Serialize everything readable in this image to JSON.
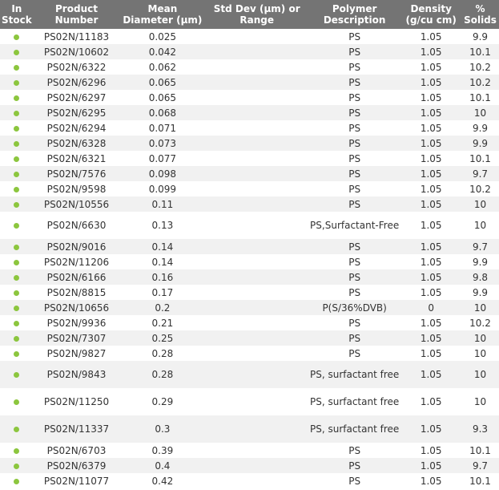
{
  "table": {
    "headers": {
      "stock": "In Stock",
      "product": "Product Number",
      "diameter": "Mean Diameter (µm)",
      "stddev": "Std Dev (µm) or Range",
      "polymer": "Polymer Description",
      "density": "Density (g/cu cm)",
      "solids": "% Solids"
    },
    "stock_indicator_color": "#8cc63e",
    "rows": [
      {
        "stock": "in-stock-dot",
        "product": "PS02N/11183",
        "diameter": "0.025",
        "stddev": "",
        "polymer": "PS",
        "density": "1.05",
        "solids": "9.9"
      },
      {
        "stock": "in-stock-dot",
        "product": "PS02N/10602",
        "diameter": "0.042",
        "stddev": "",
        "polymer": "PS",
        "density": "1.05",
        "solids": "10.1"
      },
      {
        "stock": "in-stock-dot",
        "product": "PS02N/6322",
        "diameter": "0.062",
        "stddev": "",
        "polymer": "PS",
        "density": "1.05",
        "solids": "10.2"
      },
      {
        "stock": "in-stock-dot",
        "product": "PS02N/6296",
        "diameter": "0.065",
        "stddev": "",
        "polymer": "PS",
        "density": "1.05",
        "solids": "10.2"
      },
      {
        "stock": "in-stock-dot",
        "product": "PS02N/6297",
        "diameter": "0.065",
        "stddev": "",
        "polymer": "PS",
        "density": "1.05",
        "solids": "10.1"
      },
      {
        "stock": "in-stock-dot",
        "product": "PS02N/6295",
        "diameter": "0.068",
        "stddev": "",
        "polymer": "PS",
        "density": "1.05",
        "solids": "10"
      },
      {
        "stock": "in-stock-dot",
        "product": "PS02N/6294",
        "diameter": "0.071",
        "stddev": "",
        "polymer": "PS",
        "density": "1.05",
        "solids": "9.9"
      },
      {
        "stock": "in-stock-dot",
        "product": "PS02N/6328",
        "diameter": "0.073",
        "stddev": "",
        "polymer": "PS",
        "density": "1.05",
        "solids": "9.9"
      },
      {
        "stock": "in-stock-dot",
        "product": "PS02N/6321",
        "diameter": "0.077",
        "stddev": "",
        "polymer": "PS",
        "density": "1.05",
        "solids": "10.1"
      },
      {
        "stock": "in-stock-dot",
        "product": "PS02N/7576",
        "diameter": "0.098",
        "stddev": "",
        "polymer": "PS",
        "density": "1.05",
        "solids": "9.7"
      },
      {
        "stock": "in-stock-dot",
        "product": "PS02N/9598",
        "diameter": "0.099",
        "stddev": "",
        "polymer": "PS",
        "density": "1.05",
        "solids": "10.2"
      },
      {
        "stock": "in-stock-dot",
        "product": "PS02N/10556",
        "diameter": "0.11",
        "stddev": "",
        "polymer": "PS",
        "density": "1.05",
        "solids": "10"
      },
      {
        "stock": "in-stock-dot",
        "product": "PS02N/6630",
        "diameter": "0.13",
        "stddev": "",
        "polymer": "PS,Surfactant-Free",
        "density": "1.05",
        "solids": "10",
        "tall": true
      },
      {
        "stock": "in-stock-dot",
        "product": "PS02N/9016",
        "diameter": "0.14",
        "stddev": "",
        "polymer": "PS",
        "density": "1.05",
        "solids": "9.7"
      },
      {
        "stock": "in-stock-dot",
        "product": "PS02N/11206",
        "diameter": "0.14",
        "stddev": "",
        "polymer": "PS",
        "density": "1.05",
        "solids": "9.9"
      },
      {
        "stock": "in-stock-dot",
        "product": "PS02N/6166",
        "diameter": "0.16",
        "stddev": "",
        "polymer": "PS",
        "density": "1.05",
        "solids": "9.8"
      },
      {
        "stock": "in-stock-dot",
        "product": "PS02N/8815",
        "diameter": "0.17",
        "stddev": "",
        "polymer": "PS",
        "density": "1.05",
        "solids": "9.9"
      },
      {
        "stock": "in-stock-dot",
        "product": "PS02N/10656",
        "diameter": "0.2",
        "stddev": "",
        "polymer": "P(S/36%DVB)",
        "density": "0",
        "solids": "10"
      },
      {
        "stock": "in-stock-dot",
        "product": "PS02N/9936",
        "diameter": "0.21",
        "stddev": "",
        "polymer": "PS",
        "density": "1.05",
        "solids": "10.2"
      },
      {
        "stock": "in-stock-dot",
        "product": "PS02N/7307",
        "diameter": "0.25",
        "stddev": "",
        "polymer": "PS",
        "density": "1.05",
        "solids": "10"
      },
      {
        "stock": "in-stock-dot",
        "product": "PS02N/9827",
        "diameter": "0.28",
        "stddev": "",
        "polymer": "PS",
        "density": "1.05",
        "solids": "10"
      },
      {
        "stock": "in-stock-dot",
        "product": "PS02N/9843",
        "diameter": "0.28",
        "stddev": "",
        "polymer": "PS, surfactant free",
        "density": "1.05",
        "solids": "10",
        "tall": true
      },
      {
        "stock": "in-stock-dot",
        "product": "PS02N/11250",
        "diameter": "0.29",
        "stddev": "",
        "polymer": "PS, surfactant free",
        "density": "1.05",
        "solids": "10",
        "tall": true
      },
      {
        "stock": "in-stock-dot",
        "product": "PS02N/11337",
        "diameter": "0.3",
        "stddev": "",
        "polymer": "PS, surfactant free",
        "density": "1.05",
        "solids": "9.3",
        "tall": true
      },
      {
        "stock": "in-stock-dot",
        "product": "PS02N/6703",
        "diameter": "0.39",
        "stddev": "",
        "polymer": "PS",
        "density": "1.05",
        "solids": "10.1"
      },
      {
        "stock": "in-stock-dot",
        "product": "PS02N/6379",
        "diameter": "0.4",
        "stddev": "",
        "polymer": "PS",
        "density": "1.05",
        "solids": "9.7"
      },
      {
        "stock": "in-stock-dot",
        "product": "PS02N/11077",
        "diameter": "0.42",
        "stddev": "",
        "polymer": "PS",
        "density": "1.05",
        "solids": "10.1"
      }
    ]
  }
}
